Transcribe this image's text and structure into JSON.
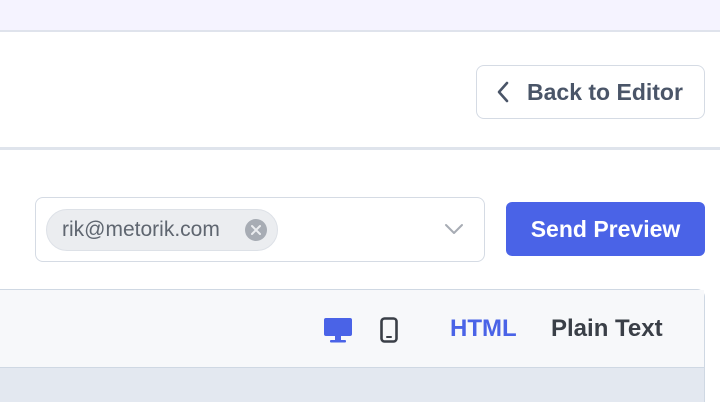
{
  "header": {
    "back_label": "Back to Editor"
  },
  "preview": {
    "recipient_chip": "rik@metorik.com",
    "send_label": "Send Preview"
  },
  "viewer": {
    "tabs": [
      {
        "label": "HTML",
        "active": true
      },
      {
        "label": "Plain Text",
        "active": false
      }
    ],
    "device_icons": [
      "desktop-icon",
      "mobile-icon"
    ],
    "active_device": "desktop"
  },
  "colors": {
    "accent": "#4a63e7",
    "top_strip": "#f5f3ff",
    "panel_body": "#e3e8f0"
  }
}
